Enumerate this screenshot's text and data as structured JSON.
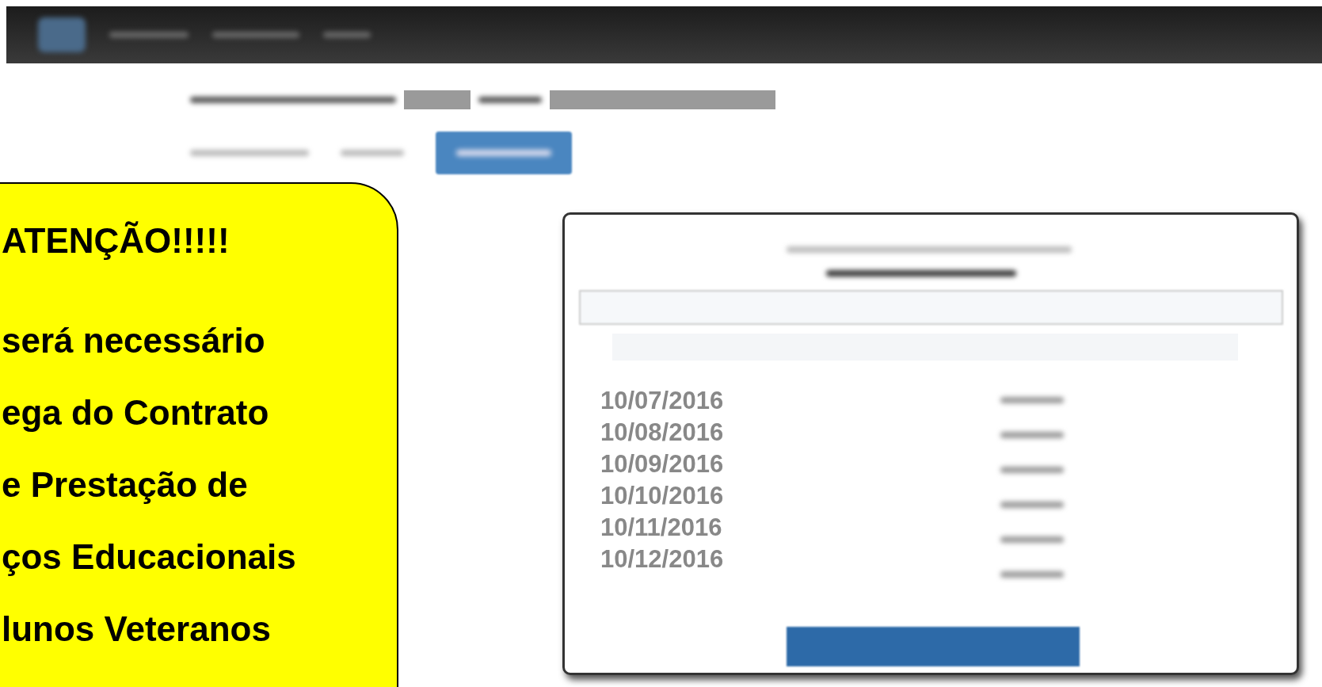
{
  "callout": {
    "title": "ATENÇÃO!!!!!",
    "lines": [
      "será necessário",
      "ega do Contrato",
      "e Prestação de",
      "ços Educacionais",
      "lunos Veteranos"
    ]
  },
  "modal": {
    "dates": [
      "10/07/2016",
      "10/08/2016",
      "10/09/2016",
      "10/10/2016",
      "10/11/2016",
      "10/12/2016"
    ]
  }
}
